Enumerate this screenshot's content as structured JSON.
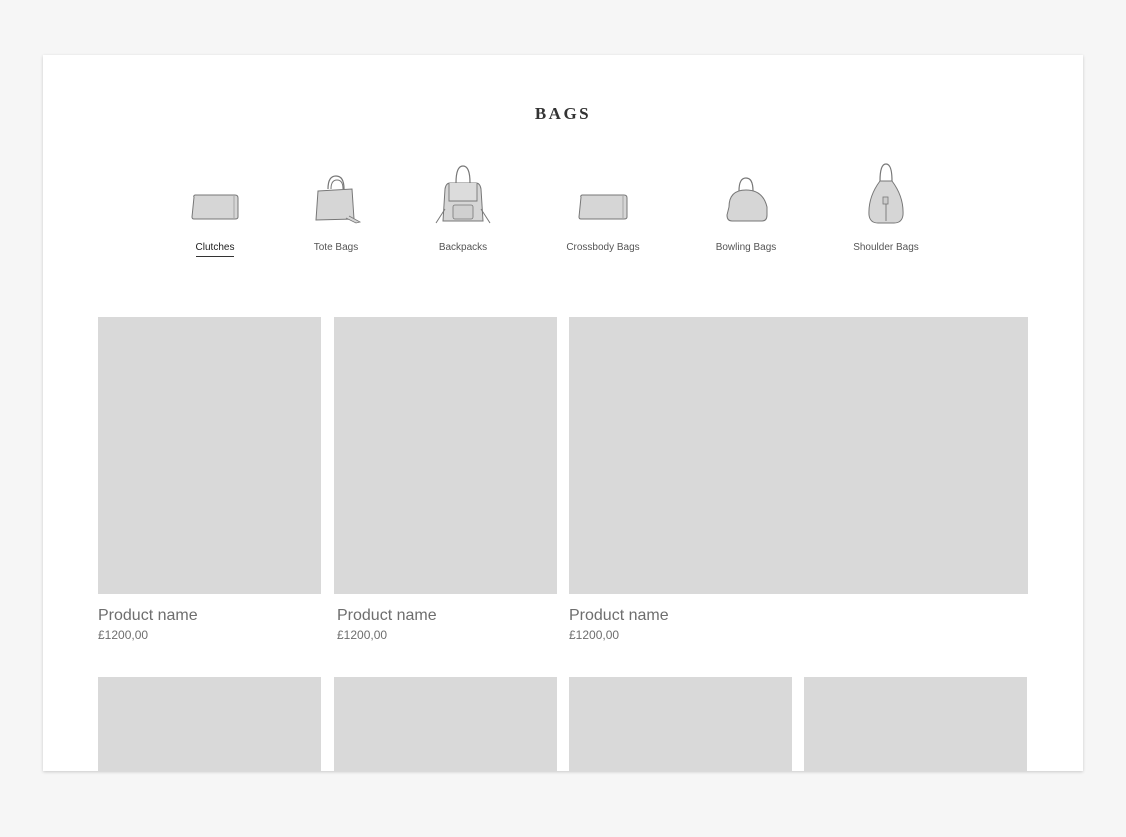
{
  "page": {
    "title": "BAGS"
  },
  "categories": [
    {
      "label": "Clutches",
      "icon": "clutch-icon",
      "active": true
    },
    {
      "label": "Tote Bags",
      "icon": "tote-bag-icon",
      "active": false
    },
    {
      "label": "Backpacks",
      "icon": "backpack-icon",
      "active": false
    },
    {
      "label": "Crossbody Bags",
      "icon": "crossbody-bag-icon",
      "active": false
    },
    {
      "label": "Bowling Bags",
      "icon": "bowling-bag-icon",
      "active": false
    },
    {
      "label": "Shoulder Bags",
      "icon": "shoulder-bag-icon",
      "active": false
    }
  ],
  "products": [
    {
      "name": "Product name",
      "price": "£1200,00"
    },
    {
      "name": "Product name",
      "price": "£1200,00"
    },
    {
      "name": "Product name",
      "price": "£1200,00"
    }
  ],
  "colors": {
    "placeholder": "#d9d9d9",
    "text": "#6e6e6e",
    "background": "#f6f6f6"
  }
}
